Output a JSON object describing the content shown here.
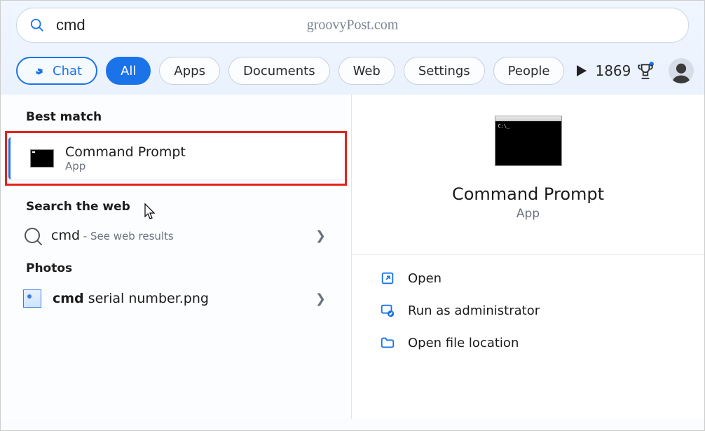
{
  "watermark": "groovyPost.com",
  "search": {
    "value": "cmd"
  },
  "filters": {
    "chat": "Chat",
    "all": "All",
    "apps": "Apps",
    "documents": "Documents",
    "web": "Web",
    "settings": "Settings",
    "people": "People"
  },
  "rewards": {
    "points": "1869"
  },
  "left": {
    "best_match_hd": "Best match",
    "best": {
      "title": "Command Prompt",
      "subtitle": "App"
    },
    "web_hd": "Search the web",
    "web_row": {
      "term": "cmd",
      "hint": " - See web results"
    },
    "photos_hd": "Photos",
    "photo_row": {
      "bold": "cmd",
      "rest": " serial number.png"
    }
  },
  "right": {
    "title": "Command Prompt",
    "subtitle": "App",
    "actions": {
      "open": "Open",
      "admin": "Run as administrator",
      "location": "Open file location"
    }
  }
}
